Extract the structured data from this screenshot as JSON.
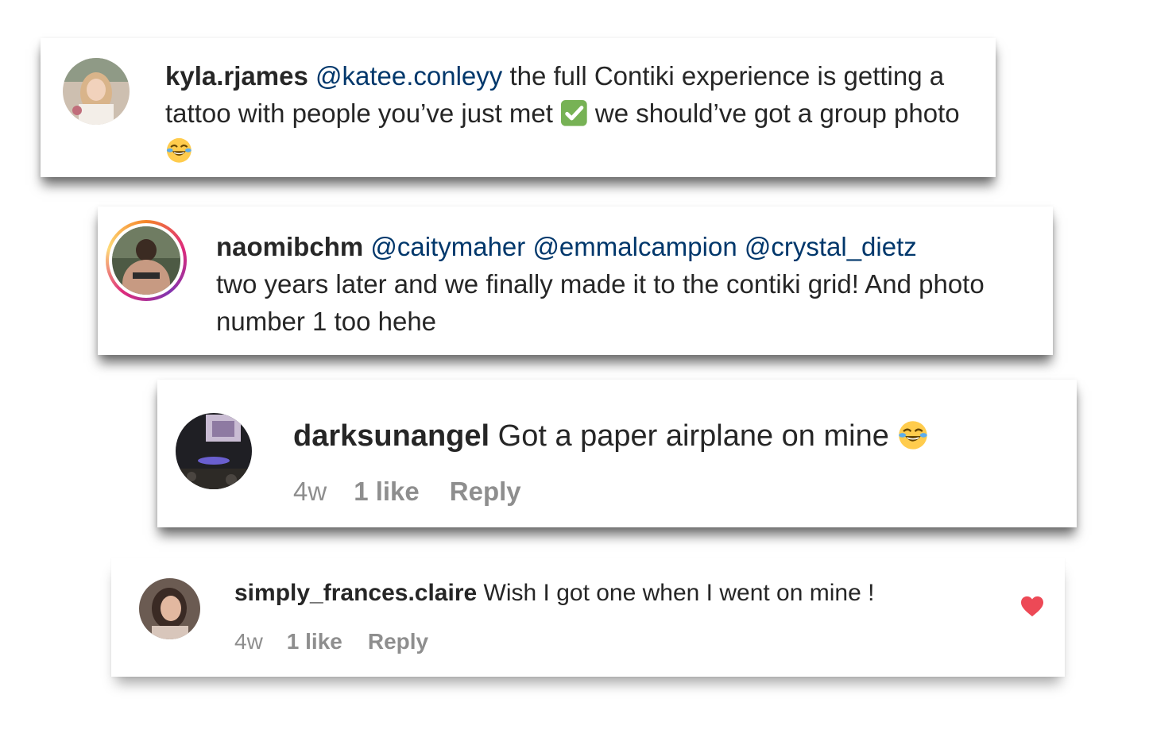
{
  "comments": [
    {
      "username": "kyla.rjames",
      "mention": "@katee.conleyy",
      "text_line1": " the full Contiki experience is getting a tattoo with people you’ve just met ",
      "text_line2": " we should’ve got a group photo ",
      "emoji_1": "check-mark-emoji",
      "emoji_2": "laughing-face-emoji"
    },
    {
      "username": "naomibchm",
      "mentions": [
        "@caitymaher",
        "@emmalcampion",
        "@crystal_dietz"
      ],
      "text": "two years later and we finally made it to the contiki grid! And photo number 1 too hehe"
    },
    {
      "username": "darksunangel",
      "text": "Got a paper airplane on mine ",
      "emoji": "laughing-face-emoji",
      "time": "4w",
      "likes": "1 like",
      "reply": "Reply"
    },
    {
      "username": "simply_frances.claire",
      "text": "Wish I got one when I went on mine !",
      "time": "4w",
      "likes": "1 like",
      "reply": "Reply",
      "liked_icon": "heart-icon"
    }
  ],
  "colors": {
    "mention": "#00376b",
    "meta": "#8e8e8e",
    "heart": "#ed4956",
    "text": "#262626"
  }
}
